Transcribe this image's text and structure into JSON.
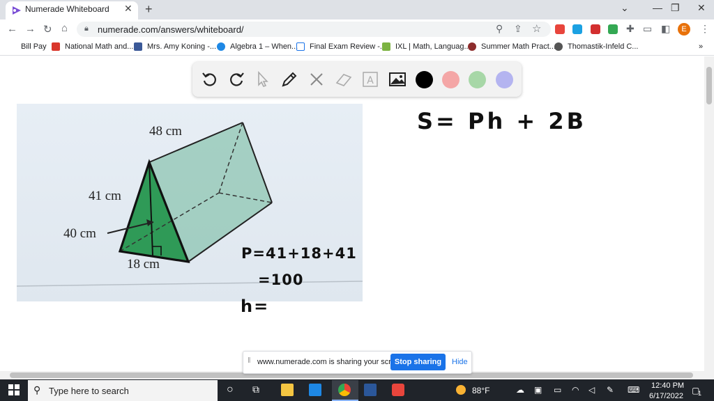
{
  "browser": {
    "tab_title": "Numerade Whiteboard",
    "tab_close": "✕",
    "new_tab": "+",
    "url": "numerade.com/answers/whiteboard/",
    "profile_initial": "E"
  },
  "bookmarks": [
    {
      "label": "Bill Pay"
    },
    {
      "label": "National Math and..."
    },
    {
      "label": "Mrs. Amy Koning -..."
    },
    {
      "label": "Algebra 1 – When..."
    },
    {
      "label": "Final Exam Review -..."
    },
    {
      "label": "IXL | Math, Languag..."
    },
    {
      "label": "Summer Math Pract..."
    },
    {
      "label": "Thomastik-Infeld C..."
    }
  ],
  "toolbar": {
    "tools": [
      "undo-icon",
      "redo-icon",
      "pointer-icon",
      "pen-icon",
      "tools-icon",
      "eraser-icon",
      "text-icon",
      "image-icon"
    ],
    "colors": [
      "#000000",
      "#f4a6a6",
      "#a7d7a7",
      "#b4b4f0"
    ]
  },
  "figure": {
    "label_top": "48 cm",
    "label_slant": "41 cm",
    "label_height": "40 cm",
    "label_base": "18 cm"
  },
  "notes": {
    "formula": "S= Ph + 2B",
    "perimeter": "P=41+18+41",
    "perimeter_result": "=100",
    "height": "h="
  },
  "share": {
    "message": "www.numerade.com is sharing your screen.",
    "stop_label": "Stop sharing",
    "hide_label": "Hide"
  },
  "taskbar": {
    "search_placeholder": "Type here to search",
    "temperature": "88°F",
    "time": "12:40 PM",
    "date": "6/17/2022",
    "notifications": "1"
  }
}
